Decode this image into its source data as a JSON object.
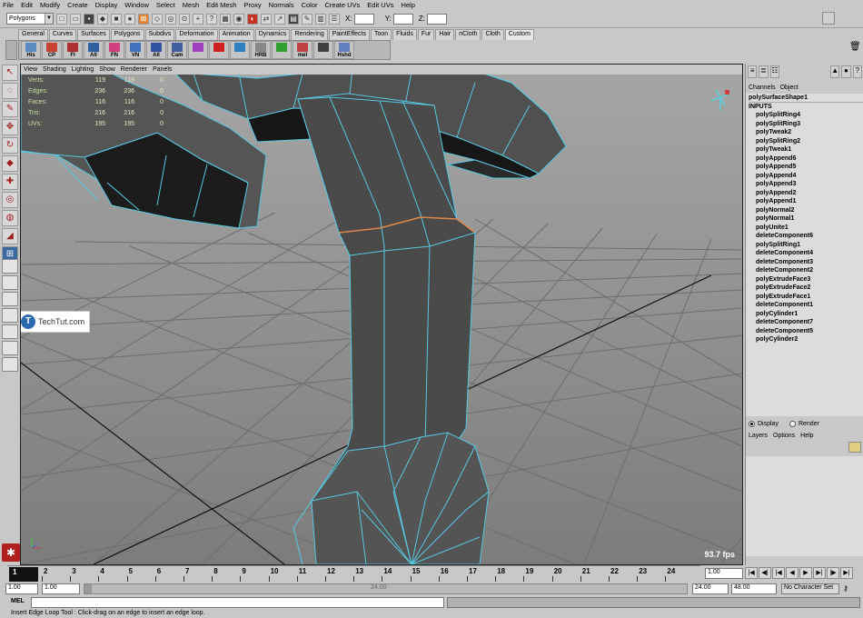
{
  "menubar": {
    "items": [
      "File",
      "Edit",
      "Modify",
      "Create",
      "Display",
      "Window",
      "Select",
      "Mesh",
      "Edit Mesh",
      "Proxy",
      "Normals",
      "Color",
      "Create UVs",
      "Edit UVs",
      "Help"
    ]
  },
  "statusline": {
    "mode": "Polygons",
    "x_label": "X:",
    "y_label": "Y:",
    "z_label": "Z:"
  },
  "shelf": {
    "tabs": [
      "General",
      "Curves",
      "Surfaces",
      "Polygons",
      "Subdivs",
      "Deformation",
      "Animation",
      "Dynamics",
      "Rendering",
      "PaintEffects",
      "Toon",
      "Fluids",
      "Fur",
      "Hair",
      "nCloth",
      "Cloth",
      "Custom"
    ],
    "active_tab": "Custom",
    "buttons": [
      "His",
      "CP",
      "FI",
      "All",
      "FN",
      "VN",
      "All",
      "Cam",
      "",
      "",
      "",
      "HRB",
      "",
      "mel",
      "",
      "Hshd"
    ]
  },
  "viewport": {
    "menu": [
      "View",
      "Shading",
      "Lighting",
      "Show",
      "Renderer",
      "Panels"
    ],
    "hud": [
      {
        "label": "Verts:",
        "a": "119",
        "b": "119",
        "c": "0"
      },
      {
        "label": "Edges:",
        "a": "236",
        "b": "236",
        "c": "0"
      },
      {
        "label": "Faces:",
        "a": "116",
        "b": "116",
        "c": "0"
      },
      {
        "label": "Tris:",
        "a": "216",
        "b": "216",
        "c": "0"
      },
      {
        "label": "UVs:",
        "a": "195",
        "b": "195",
        "c": "0"
      }
    ],
    "fps": "93.7 fps",
    "watermark": "TechTut.com",
    "watermark_logo": "T"
  },
  "channelbox": {
    "menu": [
      "Channels",
      "Object"
    ],
    "shape": "polySurfaceShape1",
    "inputs_label": "INPUTS",
    "nodes": [
      "polySplitRing4",
      "polySplitRing3",
      "polyTweak2",
      "polySplitRing2",
      "polyTweak1",
      "polyAppend6",
      "polyAppend5",
      "polyAppend4",
      "polyAppend3",
      "polyAppend2",
      "polyAppend1",
      "polyNormal2",
      "polyNormal1",
      "polyUnite1",
      "deleteComponent6",
      "polySplitRing1",
      "deleteComponent4",
      "deleteComponent3",
      "deleteComponent2",
      "polyExtrudeFace3",
      "polyExtrudeFace2",
      "polyExtrudeFace1",
      "deleteComponent1",
      "polyCylinder1",
      "deleteComponent7",
      "deleteComponent5",
      "polyCylinder2"
    ]
  },
  "layereditor": {
    "display_label": "Display",
    "render_label": "Render",
    "menu": [
      "Layers",
      "Options",
      "Help"
    ]
  },
  "timeline": {
    "current_frame": "1",
    "ticks": [
      "2",
      "3",
      "4",
      "5",
      "6",
      "7",
      "8",
      "9",
      "10",
      "11",
      "12",
      "13",
      "14",
      "15",
      "16",
      "17",
      "18",
      "19",
      "20",
      "21",
      "22",
      "23",
      "24"
    ],
    "current_time_field": "1.00"
  },
  "range": {
    "start": "1.00",
    "playback_start": "1.00",
    "slider_label": "24.00",
    "playback_end": "24.00",
    "end": "48.00",
    "character_set": "No Character Set"
  },
  "commandline": {
    "label": "MEL"
  },
  "helpline": {
    "text": "Insert Edge Loop Tool : Click-drag on an edge to insert an edge loop."
  },
  "colors": {
    "viewport_bg": "#8a8a8a",
    "mesh_face": "#4a4a4a",
    "wire": "#5ad0e0",
    "selected_edge": "#e08040"
  }
}
